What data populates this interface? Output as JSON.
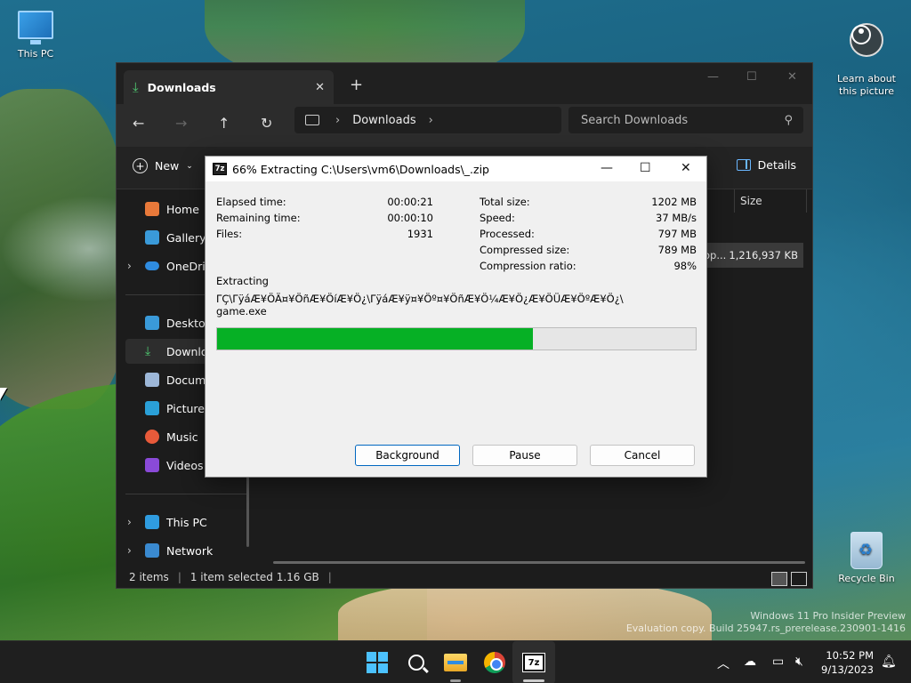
{
  "desktop": {
    "icons": {
      "this_pc": "This PC",
      "learn": "Learn about\nthis picture",
      "recycle_bin": "Recycle Bin"
    },
    "watermark_line1": "Windows 11 Pro Insider Preview",
    "watermark_line2": "Evaluation copy. Build 25947.rs_prerelease.230901-1416"
  },
  "explorer": {
    "tab_title": "Downloads",
    "address": {
      "crumb": "Downloads"
    },
    "search_placeholder": "Search Downloads",
    "toolbar": {
      "new_label": "New",
      "details_label": "Details"
    },
    "sidebar": {
      "items": [
        {
          "label": "Home"
        },
        {
          "label": "Gallery"
        },
        {
          "label": "OneDrive"
        },
        {
          "label": "Desktop"
        },
        {
          "label": "Downloads"
        },
        {
          "label": "Documents"
        },
        {
          "label": "Pictures"
        },
        {
          "label": "Music"
        },
        {
          "label": "Videos"
        },
        {
          "label": "This PC"
        },
        {
          "label": "Network"
        }
      ]
    },
    "column_size": "Size",
    "row": {
      "name_fragment": "op...",
      "size": "1,216,937 KB"
    },
    "status": {
      "items": "2 items",
      "selected": "1 item selected  1.16 GB"
    }
  },
  "dialog": {
    "title": "66% Extracting C:\\Users\\vm6\\Downloads\\_.zip",
    "icon_text": "7z",
    "left_stats": [
      {
        "label": "Elapsed time:",
        "value": "00:00:21"
      },
      {
        "label": "Remaining time:",
        "value": "00:00:10"
      },
      {
        "label": "Files:",
        "value": "1931"
      }
    ],
    "right_stats": [
      {
        "label": "Total size:",
        "value": "1202 MB"
      },
      {
        "label": "Speed:",
        "value": "37 MB/s"
      },
      {
        "label": "Processed:",
        "value": "797 MB"
      },
      {
        "label": "Compressed size:",
        "value": "789 MB"
      },
      {
        "label": "Compression ratio:",
        "value": "98%"
      }
    ],
    "section_label": "Extracting",
    "path_line1": "ΓÇ\\ΓÿáÆ¥ÖÄ¤¥ÖñÆ¥ÖíÆ¥Ö¿\\ΓÿáÆ¥ÿ¤¥Öº¤¥ÖñÆ¥Ö¼Æ¥Ö¿Æ¥ÖÜÆ¥ÖºÆ¥Ö¿\\",
    "path_line2": "game.exe",
    "progress": 0.66,
    "buttons": {
      "background": "Background",
      "pause": "Pause",
      "cancel": "Cancel"
    }
  },
  "taskbar": {
    "time": "10:52 PM",
    "date": "9/13/2023",
    "sevenz_text": "7z"
  },
  "colors": {
    "progress_fill": "#06b025",
    "accent": "#0067c0",
    "download_green": "#4ec870"
  }
}
